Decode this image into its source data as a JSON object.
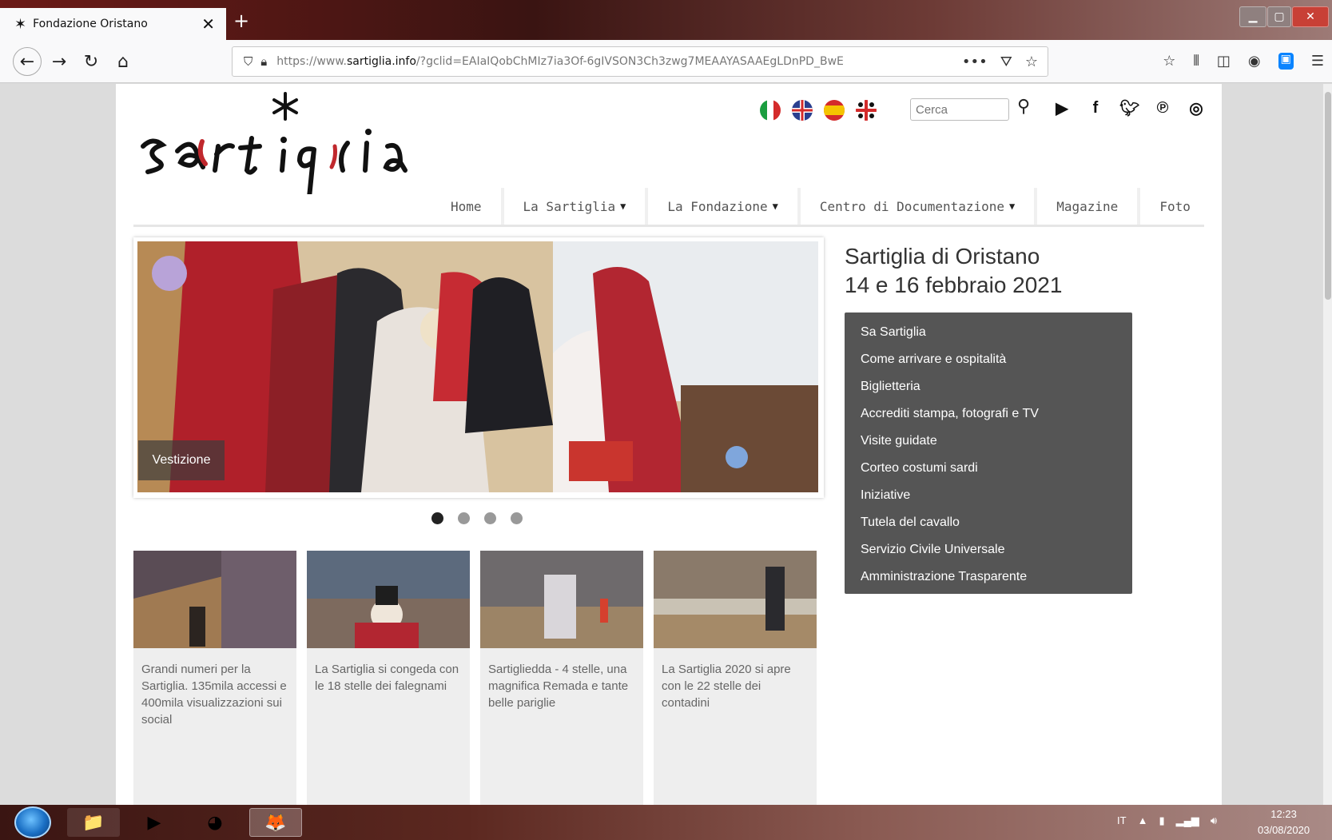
{
  "browser": {
    "tab_title": "Fondazione Oristano",
    "url_prefix": "https://www.",
    "url_domain": "sartiglia.info",
    "url_path": "/?gclid=EAIaIQobChMIz7ia3Of-6gIVSON3Ch3zwg7MEAAYASAAEgLDnPD_BwE",
    "more_label": "•••"
  },
  "site": {
    "search_placeholder": "Cerca",
    "languages": [
      "it",
      "en",
      "es",
      "sard"
    ],
    "socials": [
      "youtube-icon",
      "facebook-icon",
      "twitter-icon",
      "pinterest-icon",
      "instagram-icon"
    ],
    "nav": {
      "home": "Home",
      "la_sartiglia": "La Sartiglia",
      "la_fondazione": "La Fondazione",
      "centro": "Centro di Documentazione",
      "magazine": "Magazine",
      "foto": "Foto"
    },
    "slider_caption": "Vestizione",
    "slider_pages": 4,
    "slider_active": 1,
    "side_title_line1": "Sartiglia di Oristano",
    "side_title_line2": "14 e 16 febbraio 2021",
    "side_menu": [
      "Sa Sartiglia",
      "Come arrivare e ospitalità",
      "Biglietteria",
      "Accrediti stampa, fotografi e TV",
      "Visite guidate",
      "Corteo costumi sardi",
      "Iniziative",
      "Tutela del cavallo",
      "Servizio Civile Universale",
      "Amministrazione Trasparente"
    ],
    "cards": [
      "Grandi numeri per la Sartiglia. 135mila accessi e 400mila visualizzazioni sui social",
      "La Sartiglia si congeda con le 18 stelle dei falegnami",
      "Sartigliedda - 4 stelle, una magnifica Remada e tante belle pariglie",
      "La Sartiglia 2020 si apre con le 22 stelle dei contadini"
    ]
  },
  "taskbar": {
    "lang": "IT",
    "time": "12:23",
    "date": "03/08/2020"
  },
  "colors": {
    "menu_bg": "#555555",
    "logo_red": "#c0282d"
  }
}
